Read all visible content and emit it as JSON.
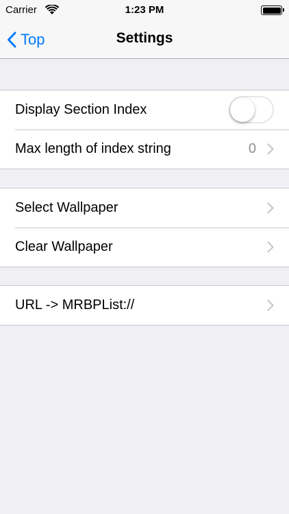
{
  "status_bar": {
    "carrier": "Carrier",
    "time": "1:23 PM"
  },
  "nav": {
    "back_label": "Top",
    "title": "Settings"
  },
  "sections": [
    {
      "rows": [
        {
          "label": "Display Section Index",
          "accessory": "switch",
          "switch_on": false
        },
        {
          "label": "Max length of index string",
          "detail": "0",
          "accessory": "chevron-right-icon"
        }
      ]
    },
    {
      "rows": [
        {
          "label": "Select Wallpaper",
          "accessory": "chevron-right-icon"
        },
        {
          "label": "Clear Wallpaper",
          "accessory": "chevron-right-icon"
        }
      ]
    },
    {
      "rows": [
        {
          "label": "URL -> MRBPList://",
          "accessory": "chevron-right-icon"
        }
      ]
    }
  ],
  "colors": {
    "accent": "#007aff",
    "background": "#efeff4",
    "separator": "#c8c7cc",
    "detail_text": "#8e8e93"
  }
}
